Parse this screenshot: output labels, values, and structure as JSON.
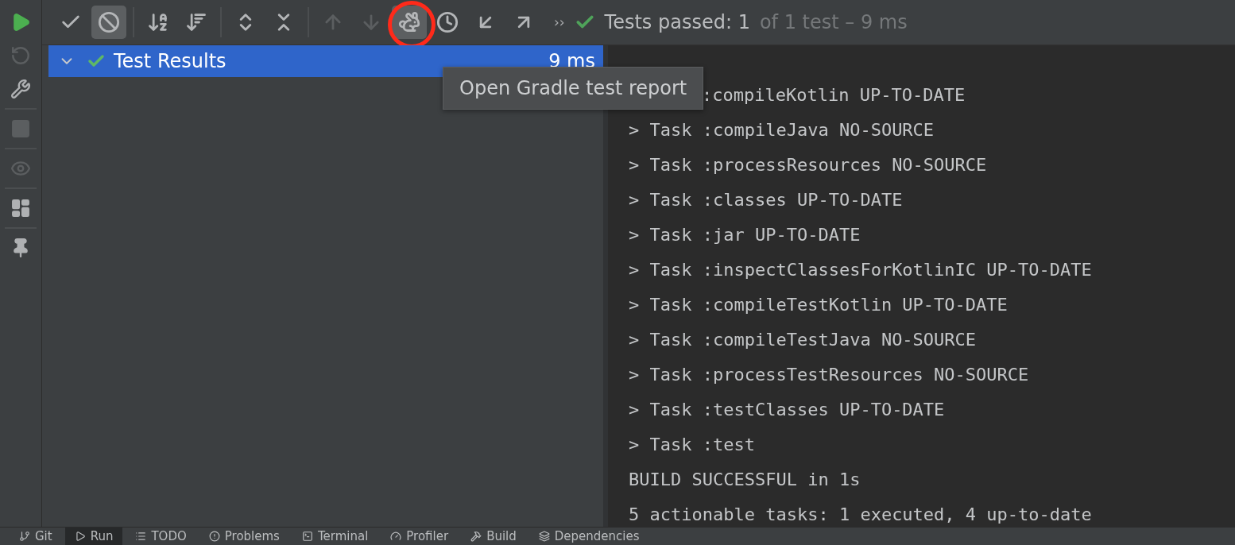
{
  "side_toolbar": [
    {
      "kind": "run",
      "disabled": false
    },
    {
      "kind": "rerun-failed",
      "disabled": true
    },
    {
      "kind": "wrench",
      "disabled": false
    },
    {
      "kind": "stop",
      "disabled": true
    },
    {
      "kind": "eye",
      "disabled": true
    },
    {
      "kind": "layout",
      "disabled": false
    },
    {
      "kind": "pin",
      "disabled": false
    }
  ],
  "toolbar": [
    {
      "kind": "check",
      "selected": false,
      "disabled": false,
      "highlighted": false
    },
    {
      "kind": "ignored",
      "selected": true,
      "disabled": false,
      "highlighted": false
    },
    {
      "kind": "sort-alpha",
      "selected": false,
      "disabled": false,
      "highlighted": false
    },
    {
      "kind": "sort-duration",
      "selected": false,
      "disabled": false,
      "highlighted": false
    },
    {
      "kind": "expand",
      "selected": false,
      "disabled": false,
      "highlighted": false
    },
    {
      "kind": "collapse",
      "selected": false,
      "disabled": false,
      "highlighted": false
    },
    {
      "kind": "up",
      "selected": false,
      "disabled": true,
      "highlighted": false
    },
    {
      "kind": "down",
      "selected": false,
      "disabled": true,
      "highlighted": false
    },
    {
      "kind": "gradle",
      "selected": true,
      "disabled": false,
      "highlighted": true
    },
    {
      "kind": "history",
      "selected": false,
      "disabled": false,
      "highlighted": false
    },
    {
      "kind": "import",
      "selected": false,
      "disabled": false,
      "highlighted": false
    },
    {
      "kind": "export",
      "selected": false,
      "disabled": false,
      "highlighted": false
    }
  ],
  "more": "››",
  "status": {
    "strong": "Tests passed: 1",
    "rest": "of 1 test – 9 ms"
  },
  "tree": [
    {
      "label": "Test Results",
      "time": "9 ms",
      "selected": true,
      "expanded": true
    }
  ],
  "tooltip": "Open Gradle test report",
  "console": [
    {
      "kind": "covered",
      "text": ":compileKotlin UP-TO-DATE"
    },
    {
      "kind": "line",
      "text": "> Task :compileJava NO-SOURCE"
    },
    {
      "kind": "line",
      "text": "> Task :processResources NO-SOURCE"
    },
    {
      "kind": "line",
      "text": "> Task :classes UP-TO-DATE"
    },
    {
      "kind": "line",
      "text": "> Task :jar UP-TO-DATE"
    },
    {
      "kind": "line",
      "text": "> Task :inspectClassesForKotlinIC UP-TO-DATE"
    },
    {
      "kind": "line",
      "text": "> Task :compileTestKotlin UP-TO-DATE"
    },
    {
      "kind": "line",
      "text": "> Task :compileTestJava NO-SOURCE"
    },
    {
      "kind": "line",
      "text": "> Task :processTestResources NO-SOURCE"
    },
    {
      "kind": "line",
      "text": "> Task :testClasses UP-TO-DATE"
    },
    {
      "kind": "line",
      "text": "> Task :test"
    },
    {
      "kind": "line",
      "text": "BUILD SUCCESSFUL in 1s"
    },
    {
      "kind": "line",
      "text": "5 actionable tasks: 1 executed, 4 up-to-date"
    }
  ],
  "bottom_tabs": [
    {
      "kind": "git",
      "label": "Git",
      "selected": false
    },
    {
      "kind": "run",
      "label": "Run",
      "selected": true
    },
    {
      "kind": "todo",
      "label": "TODO",
      "selected": false
    },
    {
      "kind": "problems",
      "label": "Problems",
      "selected": false
    },
    {
      "kind": "terminal",
      "label": "Terminal",
      "selected": false
    },
    {
      "kind": "profiler",
      "label": "Profiler",
      "selected": false
    },
    {
      "kind": "build",
      "label": "Build",
      "selected": false
    },
    {
      "kind": "dependencies",
      "label": "Dependencies",
      "selected": false
    }
  ]
}
